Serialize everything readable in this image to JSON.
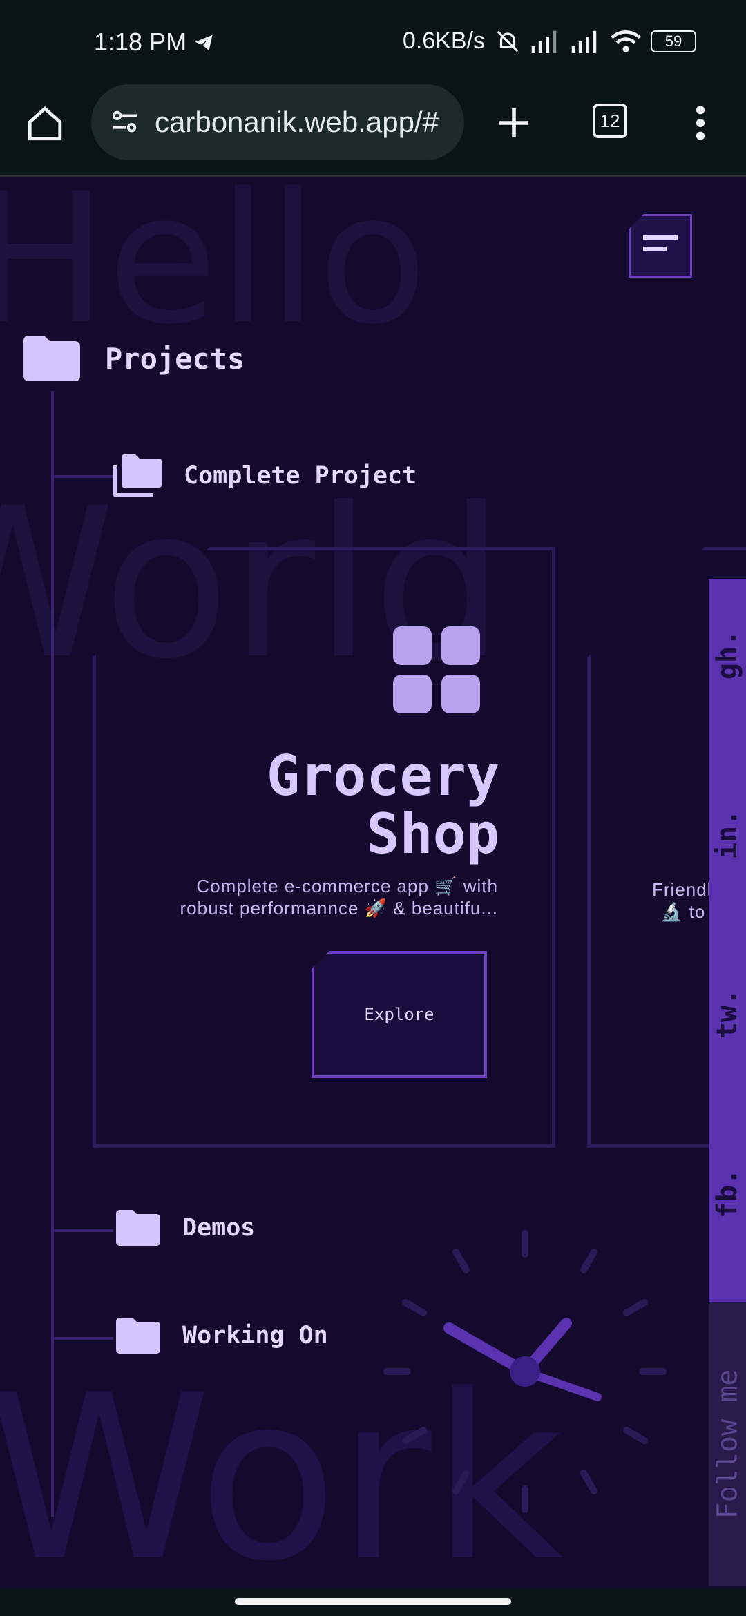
{
  "status_bar": {
    "time": "1:18 PM",
    "network_speed": "0.6KB/s",
    "battery": "59",
    "icons": [
      "telegram-icon",
      "mute-icon",
      "signal-icon",
      "signal-icon",
      "wifi-icon",
      "battery-icon"
    ]
  },
  "browser": {
    "url": "carbonanik.web.app/#",
    "tab_count": "12",
    "icons": [
      "home-icon",
      "site-settings-icon",
      "new-tab-icon",
      "tabs-icon",
      "more-icon"
    ]
  },
  "background_words": [
    "Hello",
    "World",
    "Work"
  ],
  "tree": {
    "root_label": "Projects",
    "items": [
      {
        "label": "Complete Project"
      },
      {
        "label": "Demos"
      },
      {
        "label": "Working On"
      }
    ]
  },
  "card": {
    "title_line1": "Grocery",
    "title_line2": "Shop",
    "desc_line1": "Complete e-commerce app 🛒 with",
    "desc_line2": "robust performannce 🚀 & beautifu...",
    "button_label": "Explore"
  },
  "card2": {
    "desc_line1": "Friendly 👋",
    "desc_line2": "🔬 to Des"
  },
  "social": {
    "links": [
      "gh.",
      "in.",
      "tw.",
      "fb."
    ],
    "follow_label": "Follow me"
  },
  "colors": {
    "accent": "#5b32b0",
    "background": "#140a2e",
    "text": "#e4d8ff"
  }
}
